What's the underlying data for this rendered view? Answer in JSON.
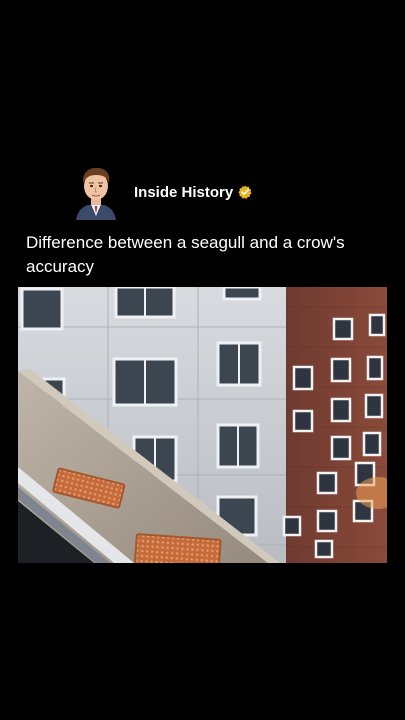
{
  "post": {
    "author_name": "Inside History",
    "caption": "Difference between a seagull and a crow's accuracy",
    "verified_badge_color": "#e6b422"
  },
  "icons": {
    "avatar": "illustrated-portrait-avatar",
    "verified": "verified-badge-icon"
  },
  "colors": {
    "background": "#000000",
    "text": "#ffffff"
  }
}
